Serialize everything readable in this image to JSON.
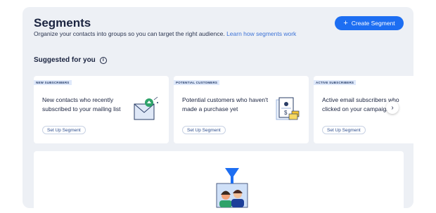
{
  "header": {
    "title": "Segments",
    "subtitle": "Organize your contacts into groups so you can target the right audience.",
    "learn_link": "Learn how segments work",
    "create_button": "Create Segment"
  },
  "suggested": {
    "heading": "Suggested for you",
    "info_glyph": "i"
  },
  "cards": [
    {
      "tag": "NEW SUBSCRIBERS",
      "description": "New contacts who recently subscribed to your mailing list",
      "button": "Set Up Segment",
      "icon": "envelope-icon"
    },
    {
      "tag": "POTENTIAL CUSTOMERS",
      "description": "Potential customers who haven't made a purchase yet",
      "button": "Set Up Segment",
      "icon": "invoice-icon"
    },
    {
      "tag": "ACTIVE SUBSCRIBERS",
      "description": "Active email subscribers who clicked on your campaign",
      "button": "Set Up Segment",
      "icon": "campaign-icon"
    }
  ],
  "carousel": {
    "next_glyph": "›"
  },
  "colors": {
    "accent": "#1d6ef2",
    "panel_bg": "#edf0f5",
    "tag_bg": "#dfe9fb"
  }
}
